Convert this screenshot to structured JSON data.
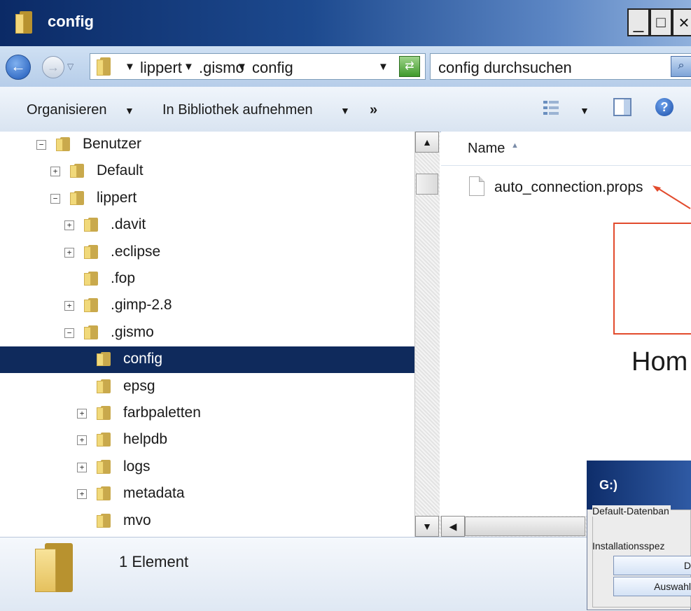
{
  "window": {
    "title": "config",
    "minimize": "_",
    "maximize": "□",
    "close": "×"
  },
  "address": {
    "segments": [
      "lippert",
      ".gismo",
      "config"
    ],
    "search_placeholder": "config durchsuchen"
  },
  "toolbar": {
    "organize": "Organisieren",
    "library": "In Bibliothek aufnehmen",
    "more": "»"
  },
  "tree": [
    {
      "label": "Benutzer",
      "level": 0,
      "expander": "minus",
      "selected": false
    },
    {
      "label": "Default",
      "level": 1,
      "expander": "plus",
      "selected": false
    },
    {
      "label": "lippert",
      "level": 1,
      "expander": "minus",
      "selected": false
    },
    {
      "label": ".davit",
      "level": 2,
      "expander": "plus",
      "selected": false
    },
    {
      "label": ".eclipse",
      "level": 2,
      "expander": "plus",
      "selected": false
    },
    {
      "label": ".fop",
      "level": 2,
      "expander": "none",
      "selected": false
    },
    {
      "label": ".gimp-2.8",
      "level": 2,
      "expander": "plus",
      "selected": false
    },
    {
      "label": ".gismo",
      "level": 2,
      "expander": "minus",
      "selected": false
    },
    {
      "label": "config",
      "level": 3,
      "expander": "none",
      "selected": true
    },
    {
      "label": "epsg",
      "level": 3,
      "expander": "none",
      "selected": false
    },
    {
      "label": "farbpaletten",
      "level": 3,
      "expander": "plus",
      "selected": false
    },
    {
      "label": "helpdb",
      "level": 3,
      "expander": "plus",
      "selected": false
    },
    {
      "label": "logs",
      "level": 3,
      "expander": "plus",
      "selected": false
    },
    {
      "label": "metadata",
      "level": 3,
      "expander": "plus",
      "selected": false
    },
    {
      "label": "mvo",
      "level": 3,
      "expander": "none",
      "selected": false
    }
  ],
  "files": {
    "column_name": "Name",
    "items": [
      "auto_connection.props"
    ]
  },
  "status": {
    "count": "1 Element"
  },
  "callout": {
    "text": "Hom"
  },
  "gismo_window": {
    "logo": "G:)",
    "group_label": "Default-Datenban",
    "install_label": "Installationsspez",
    "button1": "D",
    "button2": "Auswahl"
  },
  "colors": {
    "selection": "#0f2a5c",
    "callout": "#e24b2d",
    "title_bar": "#0b2a66"
  }
}
